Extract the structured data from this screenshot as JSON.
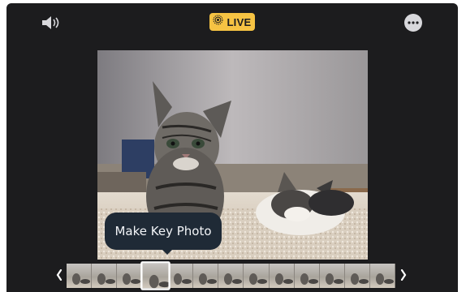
{
  "toolbar": {
    "live_label": "LIVE",
    "speaker_icon": "speaker-icon",
    "live_icon": "live-photo-icon",
    "more_icon": "more-icon"
  },
  "colors": {
    "live_badge": "#f6c343",
    "background": "#1c1c1e",
    "tooltip": "#1f2a36"
  },
  "tooltip": {
    "label": "Make Key Photo"
  },
  "filmstrip": {
    "frames": 13,
    "selected_index": 3,
    "prev_icon": "chevron-left-icon",
    "next_icon": "chevron-right-icon"
  }
}
